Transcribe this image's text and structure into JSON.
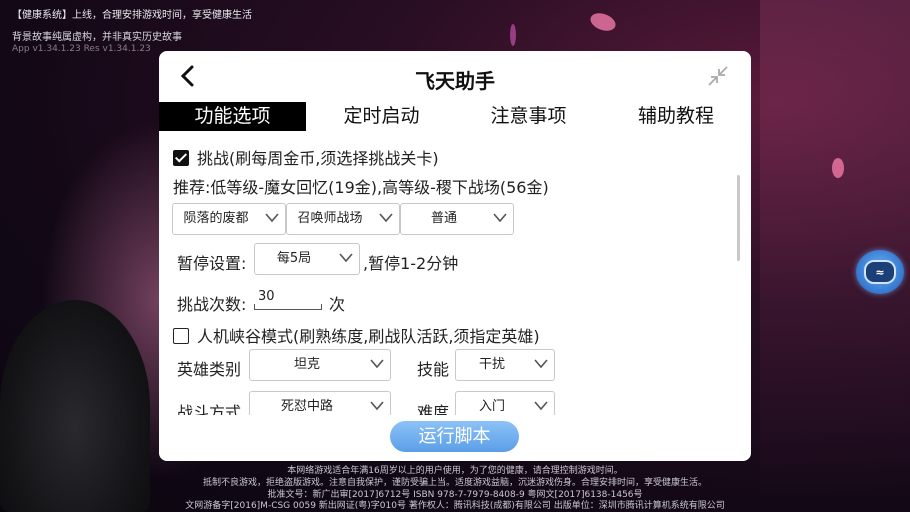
{
  "system_notice": {
    "line1": "【健康系统】上线，合理安排游戏时间，享受健康生活",
    "line2": "背景故事纯属虚构，并非真实历史故事",
    "line3": "App v1.34.1.23 Res v1.34.1.23"
  },
  "dialog": {
    "title": "飞天助手",
    "tabs": [
      "功能选项",
      "定时启动",
      "注意事项",
      "辅助教程"
    ],
    "challenge": {
      "checked": true,
      "label": "挑战(刷每周金币,须选择挑战关卡)",
      "recommend": "推荐:低等级-魔女回忆(19金),高等级-稷下战场(56金)",
      "selects": [
        "陨落的废都",
        "召唤师战场",
        "普通"
      ],
      "pause_label": "暂停设置:",
      "pause_value": "每5局",
      "pause_suffix": ",暂停1-2分钟",
      "count_label": "挑战次数:",
      "count_value": "30",
      "count_suffix": "次"
    },
    "pve": {
      "checked": false,
      "label": "人机峡谷模式(刷熟练度,刷战队活跃,须指定英雄)",
      "hero_type_label": "英雄类别",
      "hero_type_value": "坦克",
      "skill_label": "技能",
      "skill_value": "干扰",
      "fight_label": "战斗方式",
      "fight_value": "死怼中路",
      "difficulty_label": "难度",
      "difficulty_value": "入门"
    },
    "run_button": "运行脚本"
  },
  "footer": {
    "line1": "本网络游戏适合年满16周岁以上的用户使用，为了您的健康，请合理控制游戏时间。",
    "line2": "抵制不良游戏，拒绝盗版游戏。注意自我保护，谨防受骗上当。适度游戏益脑，沉迷游戏伤身。合理安排时间，享受健康生活。",
    "line3": "批准文号：新广出审[2017]6712号  ISBN 978-7-7979-8408-9  粤网文[2017]6138-1456号",
    "line4": "文网游备字[2016]M-CSG 0059  新出网证(粤)字010号  著作权人：腾讯科技(成都)有限公司  出版单位：深圳市腾讯计算机系统有限公司"
  },
  "colors": {
    "accent": "#5b9ee8",
    "tab_active_bg": "#000000"
  },
  "icons": {
    "back": "chevron-left-icon",
    "collapse": "collapse-icon",
    "assistant": "assistant-bot-icon"
  }
}
